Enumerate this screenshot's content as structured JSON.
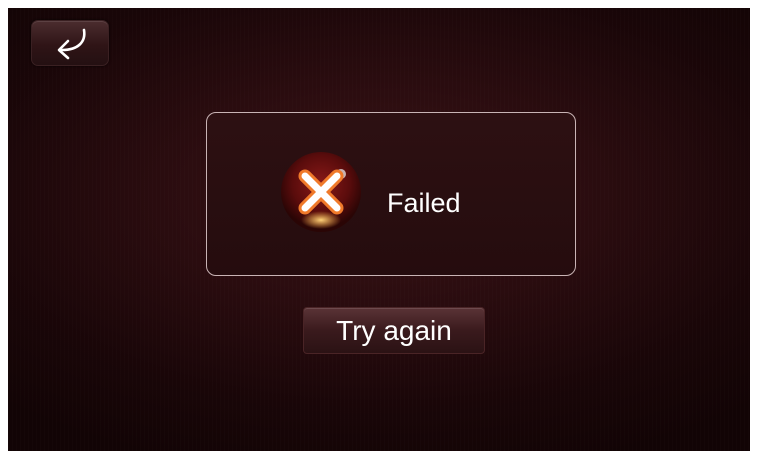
{
  "back_button": {
    "icon": "back-arrow-icon"
  },
  "status": {
    "icon": "failed-x-icon",
    "text": "Failed"
  },
  "actions": {
    "try_again_label": "Try again"
  },
  "colors": {
    "background": "#2a0c0f",
    "panel_border": "#c9b4b5",
    "icon_orange": "#f07a2a",
    "text": "#ffffff"
  }
}
